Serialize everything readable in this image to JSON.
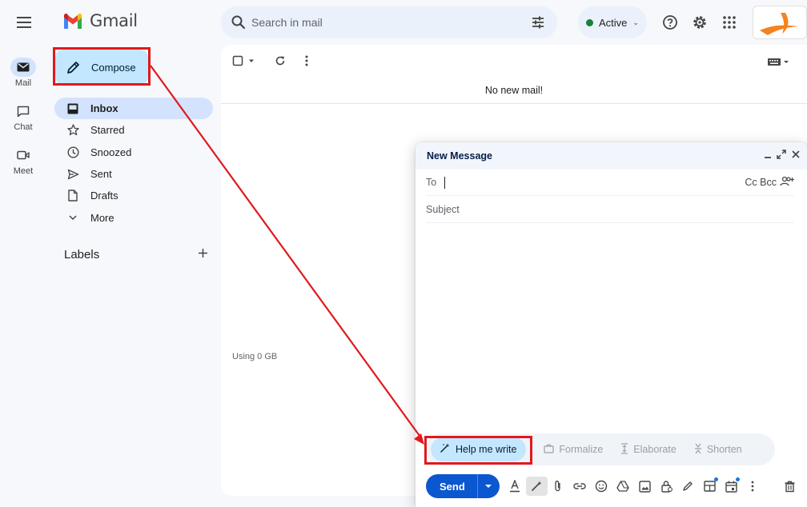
{
  "app": {
    "name": "Gmail"
  },
  "search": {
    "placeholder": "Search in mail"
  },
  "status": {
    "label": "Active",
    "color": "#188038"
  },
  "rail": [
    {
      "label": "Mail",
      "icon": "mail-icon"
    },
    {
      "label": "Chat",
      "icon": "chat-icon"
    },
    {
      "label": "Meet",
      "icon": "video-icon"
    }
  ],
  "compose_button": {
    "label": "Compose"
  },
  "nav": [
    {
      "label": "Inbox",
      "icon": "inbox-icon"
    },
    {
      "label": "Starred",
      "icon": "star-icon"
    },
    {
      "label": "Snoozed",
      "icon": "clock-icon"
    },
    {
      "label": "Sent",
      "icon": "send-icon"
    },
    {
      "label": "Drafts",
      "icon": "draft-icon"
    },
    {
      "label": "More",
      "icon": "chevron-down-icon"
    }
  ],
  "labels": {
    "heading": "Labels"
  },
  "main": {
    "empty_message": "No new mail!",
    "storage": "Using 0 GB"
  },
  "compose_window": {
    "title": "New Message",
    "to_label": "To",
    "cc_bcc": "Cc Bcc",
    "subject_placeholder": "Subject",
    "ai_options": {
      "help_me_write": "Help me write",
      "formalize": "Formalize",
      "elaborate": "Elaborate",
      "shorten": "Shorten"
    },
    "send_label": "Send"
  },
  "colors": {
    "compose_bg": "#c2e7ff",
    "nav_active": "#d3e3fd",
    "send_button": "#0b57d0",
    "annotation": "#e0191d"
  }
}
